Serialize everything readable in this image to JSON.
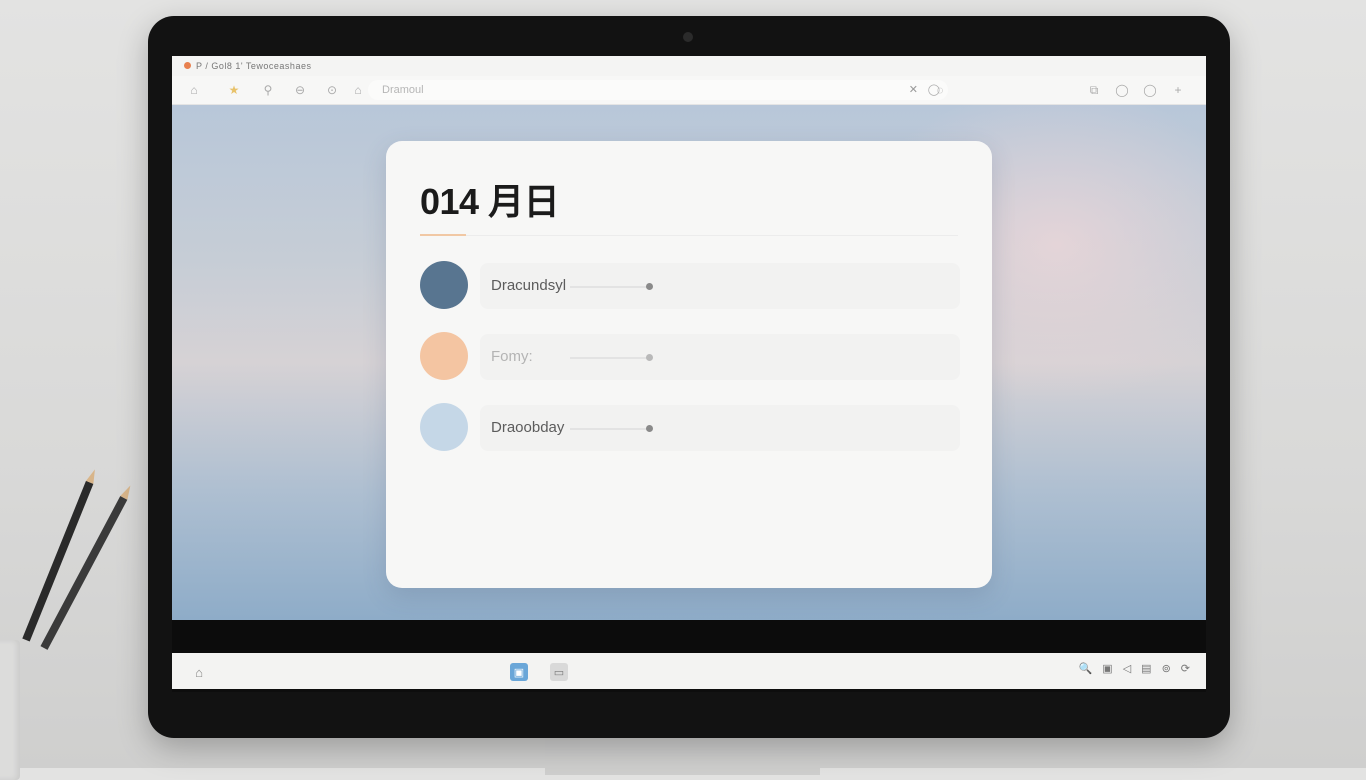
{
  "browser": {
    "title": "P / Gol8 1' Tewoceashaes",
    "address_placeholder": "Dramoul",
    "clear_glyph": "✕",
    "window_controls": [
      "⧉",
      "◯",
      "◯",
      "+"
    ]
  },
  "card": {
    "title": "014 月日",
    "items": [
      {
        "label": "Dracundsyl",
        "color": "#587590"
      },
      {
        "label": "Fomy:",
        "color": "#f4c5a2"
      },
      {
        "label": "Draoobday",
        "color": "#c5d7e7"
      }
    ]
  },
  "taskbar": {
    "tray_glyphs": [
      "🔍",
      "▣",
      "◁",
      "▤",
      "⊚",
      "⟳"
    ]
  },
  "theme": {
    "accent_peach": "#f1c8a4",
    "page_bg_top": "#b8c7d9",
    "page_bg_bottom": "#8eacc8"
  }
}
